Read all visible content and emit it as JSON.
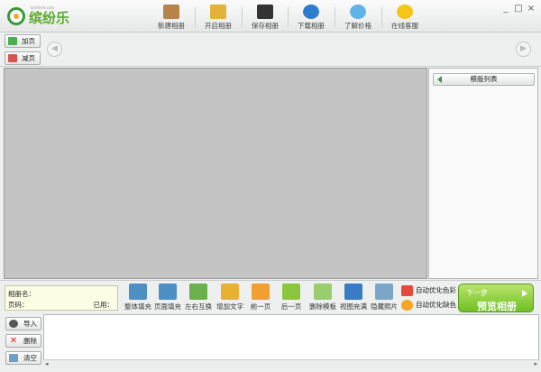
{
  "app": {
    "brand": "缤纷乐",
    "brand_sub": "binfenle.com",
    "window_controls": [
      "_",
      "□",
      "×"
    ]
  },
  "top_toolbar": [
    {
      "label": "新建相册",
      "icon": "new-album-icon",
      "color": "#b8834a"
    },
    {
      "label": "开启相册",
      "icon": "open-album-icon",
      "color": "#e2b33a"
    },
    {
      "label": "保存相册",
      "icon": "save-album-icon",
      "color": "#333333"
    },
    {
      "label": "下载相册",
      "icon": "download-globe-icon",
      "color": "#2f7bcc"
    },
    {
      "label": "了解价格",
      "icon": "price-info-icon",
      "color": "#5fb3e6"
    },
    {
      "label": "在线客服",
      "icon": "online-support-icon",
      "color": "#f5c518"
    }
  ],
  "page_buttons": {
    "add": "加页",
    "remove": "减页"
  },
  "side_panel": {
    "header": "模版列表"
  },
  "info": {
    "album_name_label": "相册名：",
    "page_label": "页码：",
    "used_label": "已用："
  },
  "tools": [
    {
      "label": "整体填充",
      "icon": "fill-whole-icon",
      "color": "#4e8fc4"
    },
    {
      "label": "页面填充",
      "icon": "fill-page-icon",
      "color": "#4e8fc4"
    },
    {
      "label": "左右互换",
      "icon": "swap-lr-icon",
      "color": "#6ab04c"
    },
    {
      "label": "增加文字",
      "icon": "add-text-icon",
      "color": "#e8b230"
    },
    {
      "label": "前一页",
      "icon": "prev-page-icon",
      "color": "#f0a030"
    },
    {
      "label": "后一页",
      "icon": "next-page-icon",
      "color": "#8cc63f"
    },
    {
      "label": "删除模板",
      "icon": "delete-template-icon",
      "color": "#9acd70"
    },
    {
      "label": "视图充满",
      "icon": "view-fill-icon",
      "color": "#3a7cc4"
    },
    {
      "label": "隐藏照片",
      "icon": "hide-photo-icon",
      "color": "#7aa7c7"
    }
  ],
  "options": {
    "auto_color": "自动优化色彩",
    "auto_missing": "自动优化缺色"
  },
  "next_button": {
    "line1": "下一步",
    "line2": "预览相册"
  },
  "left_buttons": {
    "import": "导入",
    "delete": "删除",
    "clear": "清空"
  },
  "scroll": {
    "left": "◂",
    "right": "▸"
  }
}
